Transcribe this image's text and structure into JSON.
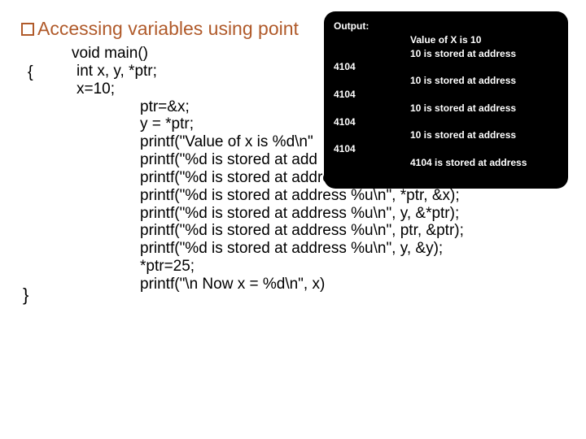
{
  "heading": "Accessing variables using point",
  "code": {
    "l1": "void main()",
    "l2": "int x, y, *ptr;",
    "l3": "x=10;",
    "l4": "ptr=&x;",
    "l5": "y = *ptr;",
    "l6": "printf(\"Value of x is %d\\n\"",
    "l7": "printf(\"%d is stored at add",
    "l8": "printf(\"%d is stored at address %u\\n\", *&x, &x);",
    "l9": "printf(\"%d is stored at address %u\\n\", *ptr, &x);",
    "l10": "printf(\"%d is stored at address %u\\n\", y, &*ptr);",
    "l11": "printf(\"%d is stored at address %u\\n\", ptr, &ptr);",
    "l12": "printf(\"%d is stored at address %u\\n\", y, &y);",
    "l13": "*ptr=25;",
    "l14": "printf(\"\\n Now x = %d\\n\", x)"
  },
  "brace_open": "{",
  "brace_close": "}",
  "output": {
    "label": "Output:",
    "r1_right": "Value of X is 10",
    "r2_right": "10 is stored at address",
    "r3_left": "4104",
    "r4_right": "10 is stored at address",
    "r5_left": "4104",
    "r6_right": "10 is stored at address",
    "r7_left": "4104",
    "r8_right": "10 is stored at address",
    "r9_left": "4104",
    "r10_right": "4104 is stored at address"
  }
}
